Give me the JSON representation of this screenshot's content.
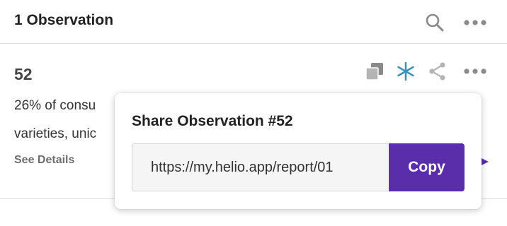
{
  "header": {
    "title": "1 Observation",
    "search_icon": "search-icon",
    "more_icon": "more-horizontal-icon"
  },
  "observation": {
    "number": "52",
    "text_line1": "26% of consu",
    "text_line2": "varieties, unic",
    "see_details_label": "See Details",
    "icons": [
      "copy-icon",
      "asterisk-icon",
      "share-icon",
      "more-horizontal-icon"
    ]
  },
  "share_popover": {
    "title": "Share Observation #52",
    "url_value": "https://my.helio.app/report/01",
    "copy_label": "Copy"
  },
  "colors": {
    "accent_purple": "#5a2eab",
    "asterisk_teal": "#3a93b8",
    "icon_gray": "#8a8a8a",
    "divider": "#dcdcdc"
  }
}
